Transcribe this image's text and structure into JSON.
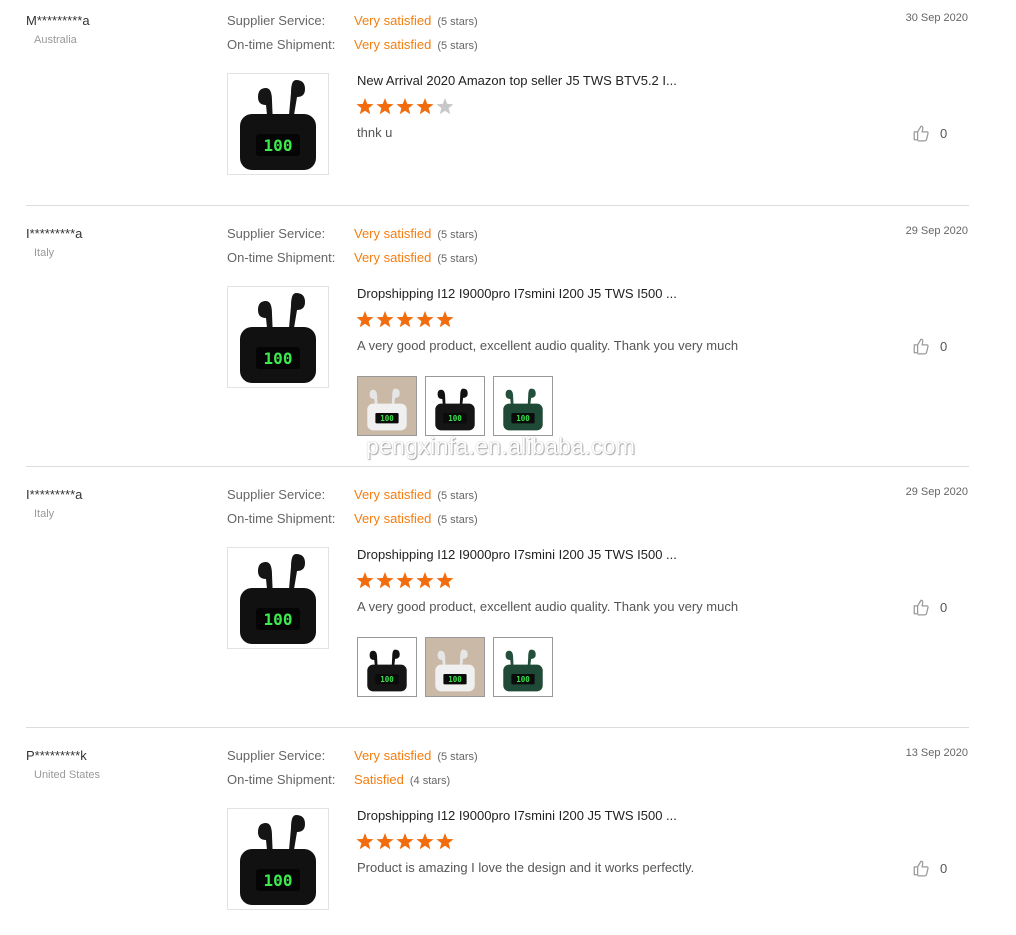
{
  "labels": {
    "supplier_service": "Supplier Service:",
    "ontime_shipment": "On-time Shipment:"
  },
  "watermark": "pengxinfa.en.alibaba.com",
  "reviews": [
    {
      "user": "M*********a",
      "country": "Australia",
      "date": "30 Sep 2020",
      "supplier_value": "Very satisfied",
      "supplier_stars": "(5 stars)",
      "shipment_value": "Very satisfied",
      "shipment_stars": "(5 stars)",
      "product_title": "New Arrival 2020 Amazon top seller J5 TWS BTV5.2 I...",
      "rating": 4,
      "text": "thnk u",
      "likes": "0",
      "photos": []
    },
    {
      "user": "I*********a",
      "country": "Italy",
      "date": "29 Sep 2020",
      "supplier_value": "Very satisfied",
      "supplier_stars": "(5 stars)",
      "shipment_value": "Very satisfied",
      "shipment_stars": "(5 stars)",
      "product_title": "Dropshipping I12 I9000pro I7smini I200 J5 TWS I500 ...",
      "rating": 5,
      "text": "A very good product, excellent audio quality. Thank you very much",
      "likes": "0",
      "photos": [
        "white",
        "black",
        "green"
      ]
    },
    {
      "user": "I*********a",
      "country": "Italy",
      "date": "29 Sep 2020",
      "supplier_value": "Very satisfied",
      "supplier_stars": "(5 stars)",
      "shipment_value": "Very satisfied",
      "shipment_stars": "(5 stars)",
      "product_title": "Dropshipping I12 I9000pro I7smini I200 J5 TWS I500 ...",
      "rating": 5,
      "text": "A very good product, excellent audio quality. Thank you very much",
      "likes": "0",
      "photos": [
        "black",
        "white",
        "green"
      ]
    },
    {
      "user": "P*********k",
      "country": "United States",
      "date": "13 Sep 2020",
      "supplier_value": "Very satisfied",
      "supplier_stars": "(5 stars)",
      "shipment_value": "Satisfied",
      "shipment_stars": "(4 stars)",
      "product_title": "Dropshipping I12 I9000pro I7smini I200 J5 TWS I500 ...",
      "rating": 5,
      "text": "Product is amazing I love the design and it works perfectly.",
      "likes": "0",
      "photos": []
    }
  ],
  "colors": {
    "accent": "#f57d0f",
    "star_on": "#f26c0d",
    "star_off": "#c8c8c8"
  }
}
